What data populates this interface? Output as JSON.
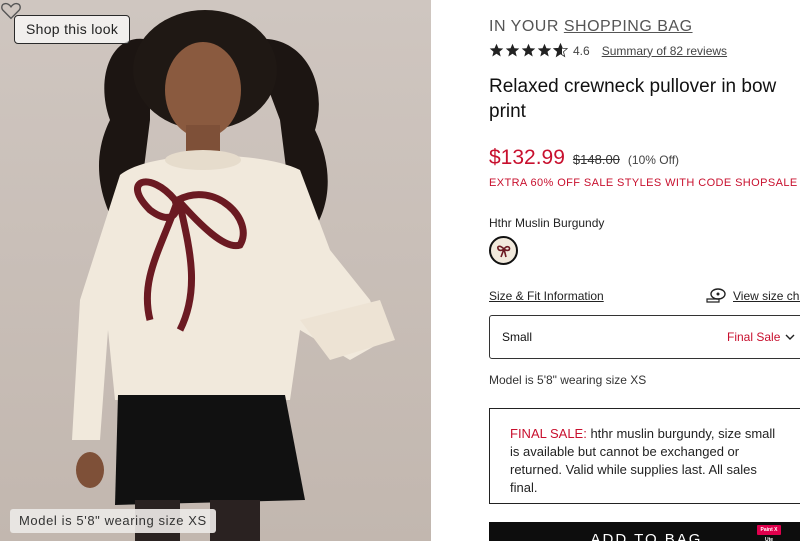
{
  "hero": {
    "shop_look_label": "Shop this look",
    "model_caption": "Model is 5'8\" wearing size XS",
    "wishlist_icon": "heart-icon"
  },
  "product": {
    "bag_prefix": "IN YOUR",
    "bag_link": "SHOPPING BAG",
    "rating_value": "4.6",
    "rating_stars": 4.6,
    "reviews_link": "Summary of 82 reviews",
    "title": "Relaxed crewneck pullover in bow print",
    "price": "$132.99",
    "original_price": "$148.00",
    "discount": "(10% Off)",
    "promo": "EXTRA 60% OFF SALE STYLES WITH CODE SHOPSALE",
    "color_name": "Hthr Muslin Burgundy",
    "size_fit_link": "Size & Fit Information",
    "size_chart_link": "View size cha",
    "size_chart_icon": "measuring-tape-icon",
    "selected_size": "Small",
    "size_tag": "Final Sale",
    "model_note": "Model is 5'8\" wearing size XS",
    "notice_label": "FINAL SALE:",
    "notice_text": " hthr muslin burgundy, size small is available but cannot be exchanged or returned. Valid while supplies last. All sales final.",
    "add_to_bag": "ADD TO BAG"
  },
  "overlay": {
    "pause_badge": "Paint X Ute"
  },
  "colors": {
    "sale_red": "#c8102e",
    "button_black": "#0d0d0d",
    "sweater_cream": "#f1e9dc",
    "bow_burgundy": "#6b1a22"
  }
}
